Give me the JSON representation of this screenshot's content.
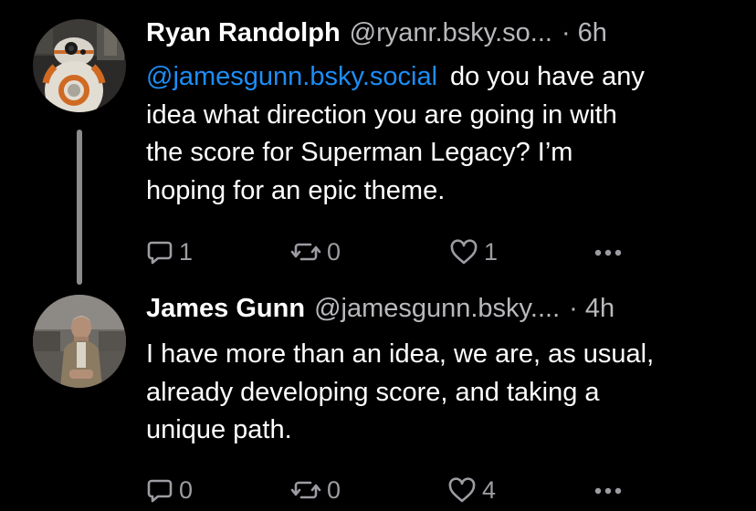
{
  "posts": [
    {
      "author_name": "Ryan Randolph",
      "handle": "@ryanr.bsky.so...",
      "separator": "·",
      "time": "6h",
      "mention": "@jamesgunn.bsky.social",
      "text_lines": [
        "do you have any",
        "idea what direction you are going in with",
        "the score for Superman Legacy? I’m",
        "hoping for an epic theme."
      ],
      "reply_count": "1",
      "repost_count": "0",
      "like_count": "1",
      "avatar_icon": "bb8-droid-avatar"
    },
    {
      "author_name": "James Gunn",
      "handle": "@jamesgunn.bsky....",
      "separator": "·",
      "time": "4h",
      "text_lines": [
        "I have more than an idea, we are, as usual,",
        "already developing score, and taking a",
        "unique path."
      ],
      "reply_count": "0",
      "repost_count": "0",
      "like_count": "4",
      "avatar_icon": "person-photo-avatar"
    }
  ],
  "colors": {
    "background": "#000000",
    "mention": "#1d8ef7",
    "muted": "#9c9ca3",
    "thread_line": "#8c8c90"
  },
  "icons": {
    "reply": "speech-bubble-icon",
    "repost": "repost-arrows-icon",
    "like": "heart-icon",
    "more": "ellipsis-icon"
  }
}
